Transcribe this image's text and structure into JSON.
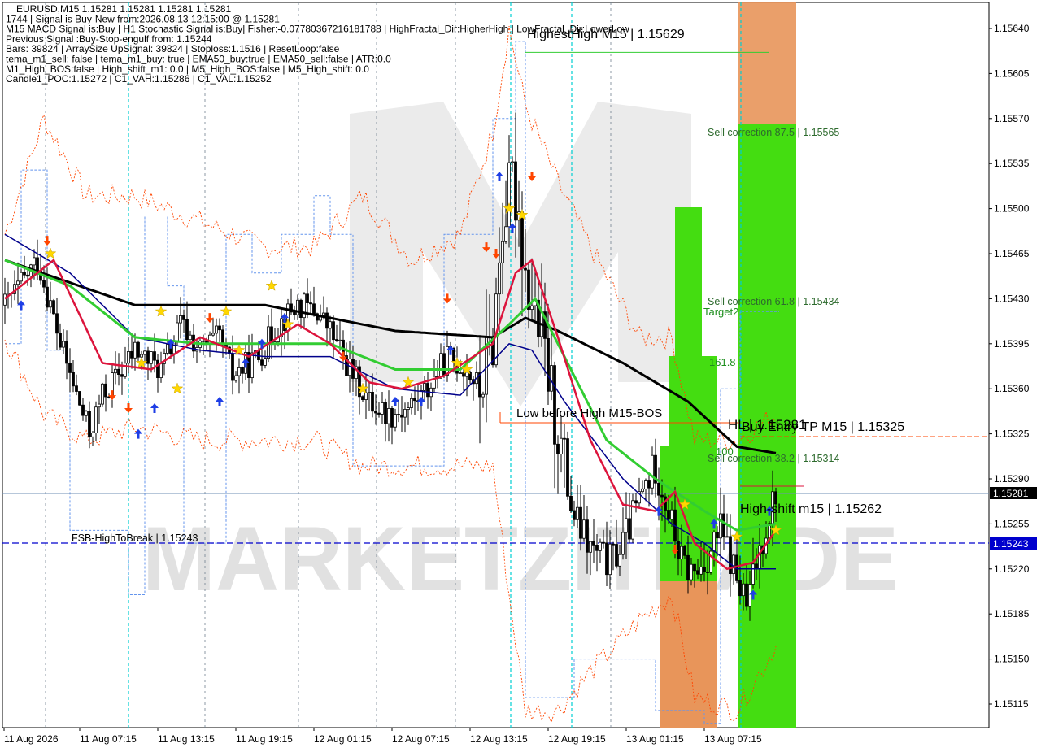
{
  "colors": {
    "background": "#ffffff",
    "watermark_fill": "#e3e3e3",
    "ema_black": "#000000",
    "ema_navy": "#00008b",
    "ema_green": "#32cd32",
    "ema_red": "#dc143c",
    "fractal_dash": "#6495ed",
    "band_dash": "#ff4500",
    "zone_green": "#44dd11",
    "zone_orange": "#e8955a",
    "cyan_vline": "#00ced1",
    "crosshair_line": "#708090",
    "price_box_dark": "#000000",
    "price_box_blue": "#0000cd",
    "star": "#ffd700",
    "arrow_up": "#1e3ee6",
    "arrow_down": "#ff4500"
  },
  "info_lines": [
    "EURUSD,M15  1.15281 1.15281 1.15281 1.15281",
    "1744 | Signal is Buy-New from:2026.08.13 12:15:00 @ 1.15281",
    "M15 MACD Signal is:Buy | H1 Stochastic Signal is:Buy| Fisher:-0.07780367216181788 | HighFractal_Dir:HigherHigh | LowFractal_Dir:LowerLow",
    "Previous Signal :Buy-Stop-engulf from: 1.15244",
    "Bars: 39824 | ArraySize UpSignal: 39824 | Stoploss:1.1516 | ResetLoop:false",
    "tema_m1_sell: false | tema_m1_buy: true | EMA50_buy:true | EMA50_sell:false | ATR:0.0",
    "M1_High_BOS:false | High_shift_m1: 0.0 | M5_High_BOS:false | M5_High_shift: 0.0",
    "Candle1_POC:1.15272 | C1_VAH:1.15286 | C1_VAL:1.15252"
  ],
  "annotations": {
    "highest_high": "HighestHigh   M15 | 1.15629",
    "sell_correction_875": "Sell correction 87.5 | 1.15565",
    "sell_correction_618": "Sell correction 61.8 | 1.15434",
    "target2": "Target2",
    "fib_1618": "161.8",
    "hl_price": "HL | 1.15281",
    "buy_entry_tp": "Buy Entry TP M15 | 1.15325",
    "fib_100": "100",
    "sell_correction_382": "Sell correction 38.2 | 1.15314",
    "low_before_high": "Low before High   M15-BOS",
    "high_shift": "High-shift m15 | 1.15262",
    "fsb_high_to_break": "FSB-HighToBreak | 1.15243",
    "watermark": "MARKETZITRADE"
  },
  "current_price": "1.15281",
  "fsb_price_label": "1.15243",
  "chart_data": {
    "type": "candlestick",
    "symbol": "EURUSD",
    "timeframe": "M15",
    "y_range": [
      1.151,
      1.1566
    ],
    "y_ticks": [
      "1.15640",
      "1.15605",
      "1.15570",
      "1.15535",
      "1.15500",
      "1.15465",
      "1.15430",
      "1.15395",
      "1.15360",
      "1.15325",
      "1.15290",
      "1.15255",
      "1.15220",
      "1.15185",
      "1.15150",
      "1.15115"
    ],
    "x_ticks": [
      "11 Aug 2026",
      "11 Aug 07:15",
      "11 Aug 13:15",
      "11 Aug 19:15",
      "12 Aug 01:15",
      "12 Aug 07:15",
      "12 Aug 13:15",
      "12 Aug 19:15",
      "13 Aug 01:15",
      "13 Aug 07:15"
    ],
    "levels": {
      "highest_high": 1.15629,
      "sell_correction_875": 1.15565,
      "sell_correction_618": 1.15434,
      "buy_entry_tp": 1.15325,
      "sell_correction_382": 1.15314,
      "low_before_high": 1.1534,
      "current": 1.15281,
      "high_shift": 1.15262,
      "fsb_high_to_break": 1.15243
    },
    "close_anchors": [
      [
        0,
        1.15425
      ],
      [
        6,
        1.15445
      ],
      [
        10,
        1.1546
      ],
      [
        14,
        1.15425
      ],
      [
        17,
        1.15395
      ],
      [
        22,
        1.15355
      ],
      [
        26,
        1.15325
      ],
      [
        30,
        1.15355
      ],
      [
        36,
        1.15375
      ],
      [
        40,
        1.1539
      ],
      [
        48,
        1.15375
      ],
      [
        54,
        1.1541
      ],
      [
        60,
        1.1539
      ],
      [
        66,
        1.154
      ],
      [
        70,
        1.1537
      ],
      [
        78,
        1.15385
      ],
      [
        84,
        1.1541
      ],
      [
        90,
        1.15425
      ],
      [
        96,
        1.1542
      ],
      [
        100,
        1.15405
      ],
      [
        106,
        1.15375
      ],
      [
        112,
        1.1535
      ],
      [
        118,
        1.1534
      ],
      [
        124,
        1.15345
      ],
      [
        130,
        1.1536
      ],
      [
        136,
        1.15385
      ],
      [
        142,
        1.15375
      ],
      [
        146,
        1.1536
      ],
      [
        150,
        1.154
      ],
      [
        153,
        1.1549
      ],
      [
        156,
        1.1552
      ],
      [
        158,
        1.155
      ],
      [
        160,
        1.1545
      ],
      [
        163,
        1.1542
      ],
      [
        166,
        1.15385
      ],
      [
        169,
        1.1534
      ],
      [
        172,
        1.153
      ],
      [
        175,
        1.1526
      ],
      [
        180,
        1.15235
      ],
      [
        186,
        1.15225
      ],
      [
        190,
        1.1524
      ],
      [
        196,
        1.1528
      ],
      [
        200,
        1.153
      ],
      [
        204,
        1.15265
      ],
      [
        208,
        1.15225
      ],
      [
        212,
        1.15215
      ],
      [
        216,
        1.1523
      ],
      [
        220,
        1.1525
      ],
      [
        224,
        1.1522
      ],
      [
        228,
        1.1519
      ],
      [
        231,
        1.15225
      ],
      [
        234,
        1.15255
      ],
      [
        237,
        1.15281
      ]
    ],
    "ema_black_anchors": [
      [
        0,
        1.1546
      ],
      [
        40,
        1.15425
      ],
      [
        80,
        1.15425
      ],
      [
        120,
        1.15405
      ],
      [
        150,
        1.154
      ],
      [
        160,
        1.15415
      ],
      [
        170,
        1.15405
      ],
      [
        190,
        1.1538
      ],
      [
        210,
        1.1535
      ],
      [
        225,
        1.15315
      ],
      [
        237,
        1.1531
      ]
    ],
    "ema_navy_anchors": [
      [
        0,
        1.1548
      ],
      [
        20,
        1.1545
      ],
      [
        40,
        1.154
      ],
      [
        60,
        1.1539
      ],
      [
        80,
        1.15385
      ],
      [
        100,
        1.15385
      ],
      [
        120,
        1.1536
      ],
      [
        140,
        1.15355
      ],
      [
        155,
        1.15395
      ],
      [
        162,
        1.1539
      ],
      [
        172,
        1.1535
      ],
      [
        190,
        1.1529
      ],
      [
        205,
        1.15255
      ],
      [
        215,
        1.1524
      ],
      [
        225,
        1.1522
      ],
      [
        237,
        1.1522
      ]
    ],
    "ema_green_anchors": [
      [
        0,
        1.1546
      ],
      [
        20,
        1.1544
      ],
      [
        40,
        1.154
      ],
      [
        60,
        1.15395
      ],
      [
        80,
        1.15395
      ],
      [
        100,
        1.15395
      ],
      [
        120,
        1.15375
      ],
      [
        140,
        1.15375
      ],
      [
        155,
        1.1541
      ],
      [
        163,
        1.1543
      ],
      [
        172,
        1.15385
      ],
      [
        185,
        1.1532
      ],
      [
        200,
        1.1529
      ],
      [
        215,
        1.15265
      ],
      [
        225,
        1.1525
      ],
      [
        237,
        1.15255
      ]
    ],
    "ema_red_anchors": [
      [
        0,
        1.1543
      ],
      [
        15,
        1.1546
      ],
      [
        30,
        1.1538
      ],
      [
        45,
        1.15375
      ],
      [
        60,
        1.154
      ],
      [
        75,
        1.15385
      ],
      [
        90,
        1.1541
      ],
      [
        100,
        1.15395
      ],
      [
        112,
        1.15365
      ],
      [
        122,
        1.1536
      ],
      [
        135,
        1.1537
      ],
      [
        150,
        1.15395
      ],
      [
        157,
        1.1545
      ],
      [
        162,
        1.1546
      ],
      [
        170,
        1.154
      ],
      [
        180,
        1.1532
      ],
      [
        190,
        1.1527
      ],
      [
        200,
        1.15265
      ],
      [
        206,
        1.1528
      ],
      [
        212,
        1.1524
      ],
      [
        222,
        1.1522
      ],
      [
        230,
        1.15225
      ],
      [
        237,
        1.1525
      ]
    ],
    "upper_band_anchors": [
      [
        0,
        1.1548
      ],
      [
        12,
        1.1557
      ],
      [
        25,
        1.1551
      ],
      [
        40,
        1.1551
      ],
      [
        60,
        1.1549
      ],
      [
        80,
        1.1547
      ],
      [
        95,
        1.1547
      ],
      [
        110,
        1.1551
      ],
      [
        125,
        1.1546
      ],
      [
        140,
        1.1548
      ],
      [
        150,
        1.1556
      ],
      [
        155,
        1.1564
      ],
      [
        160,
        1.1558
      ],
      [
        170,
        1.1552
      ],
      [
        180,
        1.1547
      ],
      [
        195,
        1.154
      ],
      [
        205,
        1.154
      ],
      [
        212,
        1.1532
      ],
      [
        225,
        1.1532
      ],
      [
        237,
        1.1534
      ]
    ],
    "lower_band_anchors": [
      [
        0,
        1.154
      ],
      [
        12,
        1.1534
      ],
      [
        25,
        1.1532
      ],
      [
        40,
        1.1533
      ],
      [
        60,
        1.1532
      ],
      [
        80,
        1.1532
      ],
      [
        95,
        1.1532
      ],
      [
        110,
        1.153
      ],
      [
        125,
        1.153
      ],
      [
        140,
        1.153
      ],
      [
        150,
        1.153
      ],
      [
        155,
        1.152
      ],
      [
        160,
        1.1511
      ],
      [
        170,
        1.1511
      ],
      [
        180,
        1.1514
      ],
      [
        195,
        1.1518
      ],
      [
        205,
        1.152
      ],
      [
        212,
        1.1512
      ],
      [
        225,
        1.1511
      ],
      [
        237,
        1.1516
      ]
    ],
    "fractal_steps": [
      [
        0,
        1.15395
      ],
      [
        5,
        1.1553
      ],
      [
        13,
        1.1539
      ],
      [
        20,
        1.1525
      ],
      [
        38,
        1.152
      ],
      [
        43,
        1.15495
      ],
      [
        50,
        1.1544
      ],
      [
        55,
        1.1524
      ],
      [
        68,
        1.1548
      ],
      [
        76,
        1.1545
      ],
      [
        85,
        1.1548
      ],
      [
        95,
        1.1551
      ],
      [
        100,
        1.1548
      ],
      [
        107,
        1.153
      ],
      [
        113,
        1.153
      ],
      [
        120,
        1.153
      ],
      [
        125,
        1.153
      ],
      [
        135,
        1.1548
      ],
      [
        142,
        1.1548
      ],
      [
        150,
        1.1557
      ],
      [
        157,
        1.1563
      ],
      [
        160,
        1.1512
      ],
      [
        175,
        1.1515
      ],
      [
        195,
        1.1515
      ],
      [
        200,
        1.1511
      ],
      [
        215,
        1.151
      ],
      [
        220,
        1.1536
      ],
      [
        226,
        1.1542
      ],
      [
        237,
        1.1542
      ]
    ],
    "stars": [
      [
        14,
        1.15465
      ],
      [
        42,
        1.1538
      ],
      [
        48,
        1.1542
      ],
      [
        53,
        1.1536
      ],
      [
        68,
        1.1542
      ],
      [
        72,
        1.1539
      ],
      [
        82,
        1.1544
      ],
      [
        87,
        1.1541
      ],
      [
        110,
        1.1536
      ],
      [
        124,
        1.15365
      ],
      [
        139,
        1.1538
      ],
      [
        142,
        1.15375
      ],
      [
        155,
        1.155
      ],
      [
        159,
        1.15495
      ],
      [
        209,
        1.1527
      ],
      [
        225,
        1.15245
      ],
      [
        237,
        1.1525
      ]
    ],
    "up_arrows": [
      [
        5,
        1.15425
      ],
      [
        41,
        1.15325
      ],
      [
        46,
        1.15345
      ],
      [
        51,
        1.15395
      ],
      [
        66,
        1.1535
      ],
      [
        74,
        1.1538
      ],
      [
        79,
        1.15395
      ],
      [
        86,
        1.15415
      ],
      [
        120,
        1.1535
      ],
      [
        128,
        1.1535
      ],
      [
        137,
        1.1539
      ],
      [
        152,
        1.15525
      ],
      [
        156,
        1.15485
      ],
      [
        201,
        1.15265
      ],
      [
        218,
        1.15255
      ],
      [
        230,
        1.152
      ],
      [
        235,
        1.15265
      ]
    ],
    "down_arrows": [
      [
        13,
        1.15475
      ],
      [
        33,
        1.15355
      ],
      [
        38,
        1.15345
      ],
      [
        63,
        1.15415
      ],
      [
        104,
        1.15385
      ],
      [
        136,
        1.1543
      ],
      [
        148,
        1.1547
      ],
      [
        151,
        1.15465
      ],
      [
        162,
        1.15525
      ],
      [
        206,
        1.15235
      ]
    ]
  }
}
